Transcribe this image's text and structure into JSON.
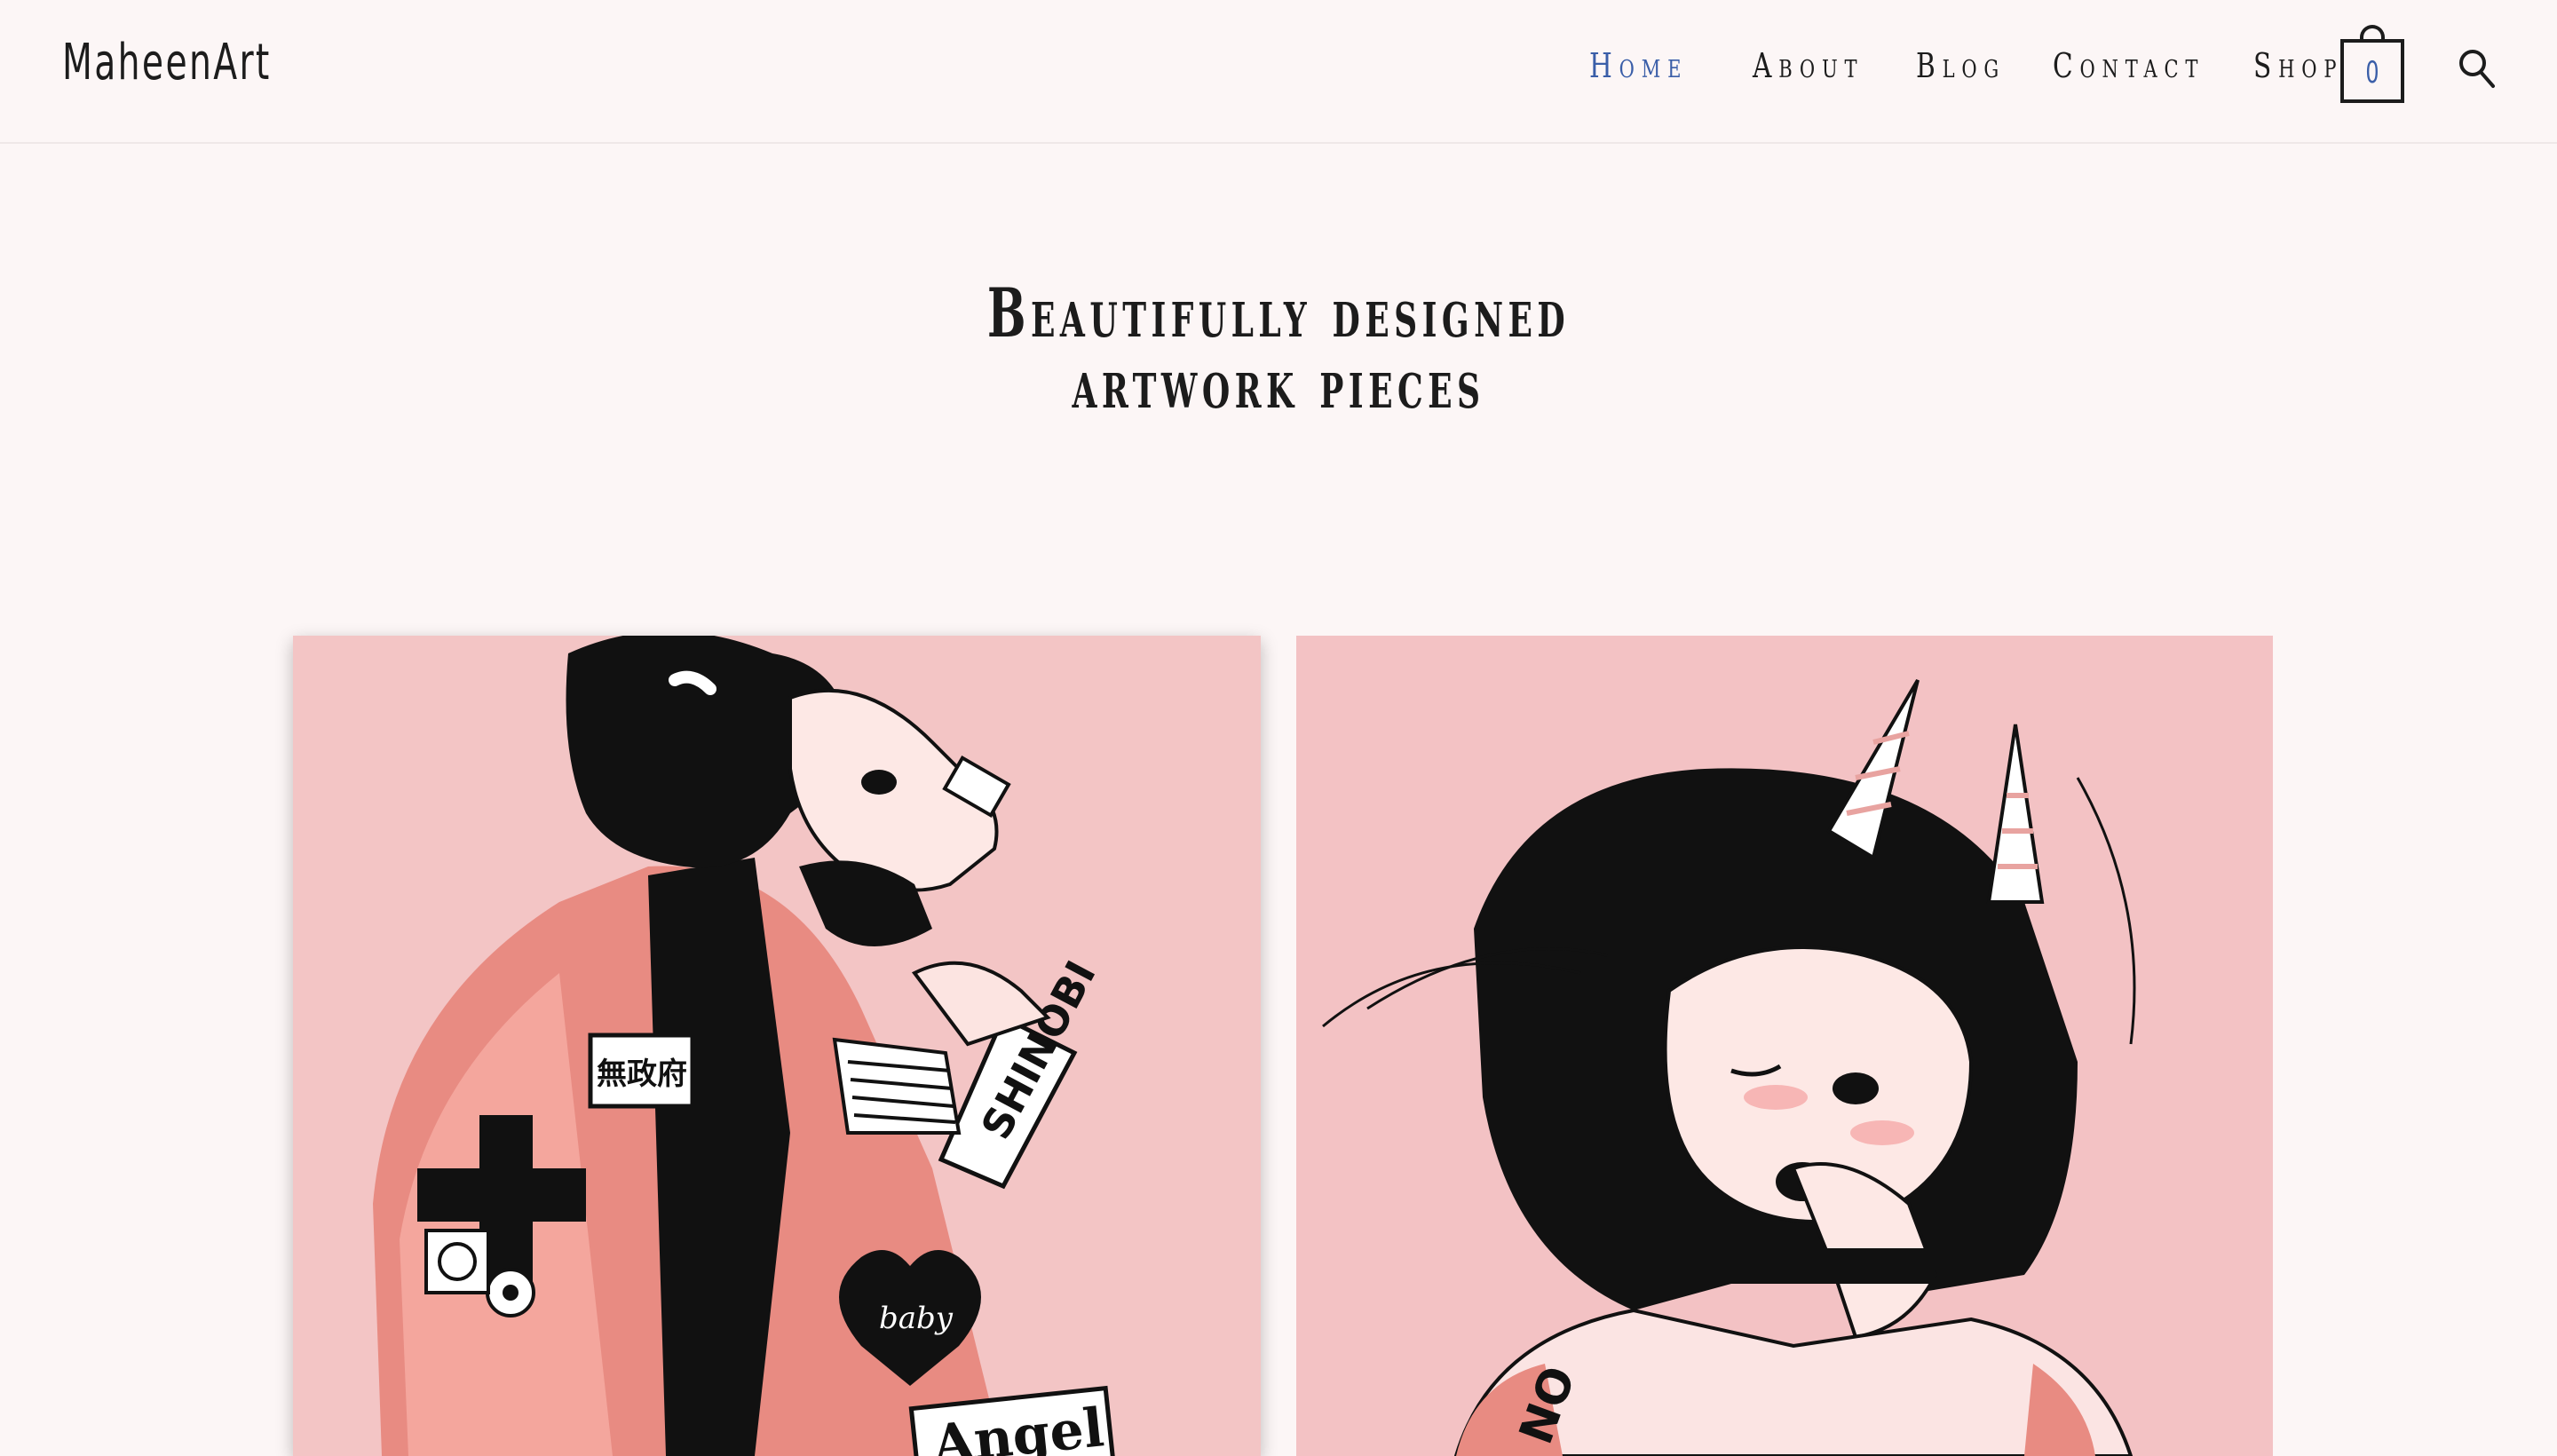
{
  "site": {
    "logo": "MaheenArt"
  },
  "nav": {
    "items": [
      {
        "label": "Home",
        "active": true
      },
      {
        "label": "About",
        "active": false
      },
      {
        "label": "Blog",
        "active": false
      },
      {
        "label": "Contact",
        "active": false
      },
      {
        "label": "Shop",
        "active": false
      }
    ],
    "cart_count": "0",
    "cart_icon": "shopping-bag-icon",
    "search_icon": "search-icon"
  },
  "hero": {
    "title_line1": "Beautifully designed",
    "title_line2": "artwork pieces"
  },
  "gallery": {
    "artwork_1": {
      "patch_text_1": "無政府",
      "patch_text_2": "SHINOBI",
      "patch_text_3": "baby",
      "patch_text_4": "Angel"
    },
    "artwork_2": {
      "patch_text_1": "NO"
    }
  },
  "colors": {
    "background": "#fcf6f6",
    "text": "#1c1c1c",
    "accent": "#3a5ea8",
    "art_pink": "#f2c6c6",
    "art_salmon": "#e8897f"
  }
}
